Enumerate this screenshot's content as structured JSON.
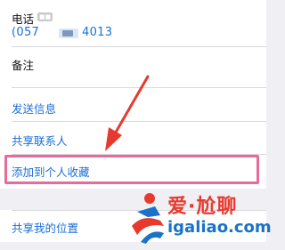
{
  "contact": {
    "phone_label": "电话",
    "phone_badge": "■■",
    "phone_number_start": "(057",
    "phone_number_end": "4013",
    "notes_label": "备注"
  },
  "actions": {
    "send_message": "发送信息",
    "share_contact": "共享联系人",
    "add_favorite": "添加到个人收藏",
    "share_location": "共享我的位置"
  },
  "watermark": {
    "brand_top": "爱·尬聊",
    "brand_bottom": "igaliao.com"
  },
  "colors": {
    "link": "#1a6fd8",
    "highlight": "#e86b9a",
    "arrow": "#e8392e",
    "logo_red": "#e8392e",
    "logo_blue": "#1a73c8"
  }
}
